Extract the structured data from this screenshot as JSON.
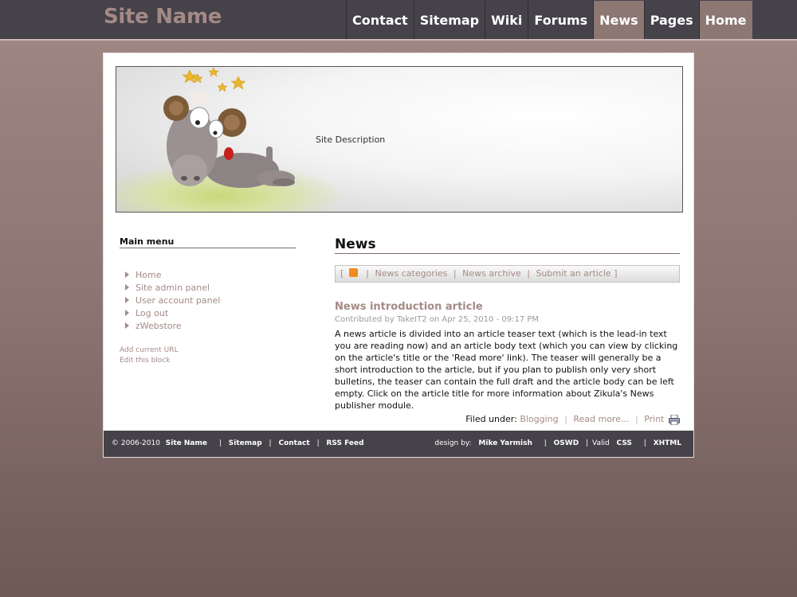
{
  "site": {
    "name": "Site Name",
    "description": "Site Description"
  },
  "nav": {
    "items": [
      {
        "label": "Contact"
      },
      {
        "label": "Sitemap"
      },
      {
        "label": "Wiki"
      },
      {
        "label": "Forums"
      },
      {
        "label": "News",
        "active": true
      },
      {
        "label": "Pages"
      },
      {
        "label": "Home"
      }
    ]
  },
  "sidebar": {
    "title": "Main menu",
    "items": [
      {
        "label": "Home"
      },
      {
        "label": "Site admin panel"
      },
      {
        "label": "User account panel"
      },
      {
        "label": "Log out"
      },
      {
        "label": "zWebstore"
      }
    ],
    "add_url": "Add current URL",
    "edit_block": "Edit this block"
  },
  "main": {
    "title": "News",
    "subnav": {
      "open_bracket": "[",
      "close_bracket": "]",
      "separator": "|",
      "categories": "News categories",
      "archive": "News archive",
      "submit": "Submit an article"
    },
    "article": {
      "title": "News introduction article",
      "byline": "Contributed by TakeIT2 on Apr 25, 2010 - 09:17 PM",
      "teaser": "A news article is divided into an article teaser text (which is the lead-in text you are reading now) and an article body text (which you can view by clicking on the article's title or the 'Read more' link). The teaser will generally be a short introduction to the article, but if you plan to publish only very short bulletins, the teaser can contain the full draft and the article body can be left empty. Click on the article title for more information about Zikula's News publisher module.",
      "filed_under": "Filed under:",
      "category": "Blogging",
      "read_more": "Read more...",
      "print": "Print"
    }
  },
  "footer": {
    "copyright": "© 2006-2010",
    "site_name": "Site Name",
    "sitemap": "Sitemap",
    "contact": "Contact",
    "rss": "RSS Feed",
    "separator": "|",
    "design_by": "design by:",
    "designer": "Mike Yarmish",
    "oswd": "OSWD",
    "valid": "Valid",
    "css": "CSS",
    "xhtml": "XHTML"
  },
  "colors": {
    "accent": "#a48a86",
    "bar": "#46424a",
    "active_tab": "#8c7773"
  }
}
